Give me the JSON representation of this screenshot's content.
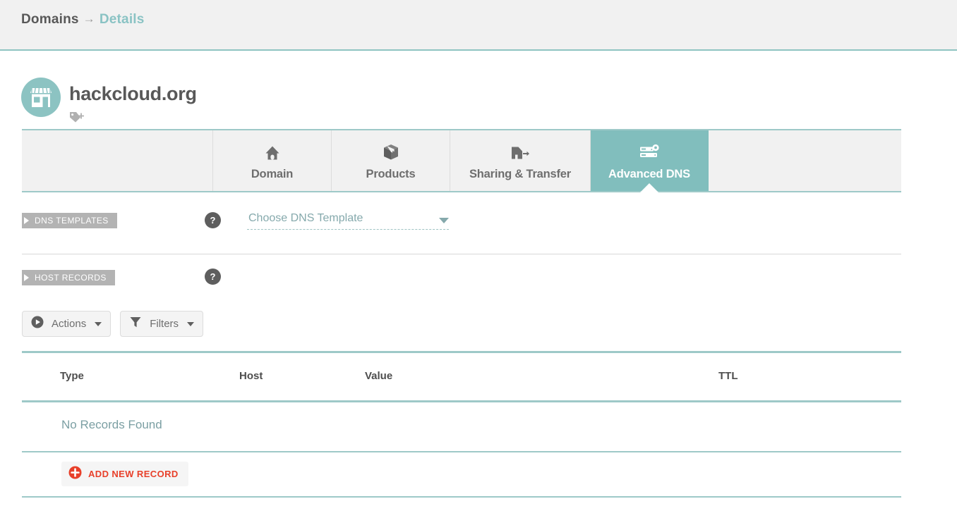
{
  "breadcrumb": {
    "root": "Domains",
    "separator": "→",
    "current": "Details"
  },
  "domain": {
    "name": "hackcloud.org",
    "avatar_icon": "storefront-icon",
    "add_tag_icon": "tag-plus-icon",
    "accent_color": "#8cc3c2"
  },
  "tabs": [
    {
      "label": "Domain",
      "icon": "house-icon",
      "active": false
    },
    {
      "label": "Products",
      "icon": "box-icon",
      "active": false
    },
    {
      "label": "Sharing & Transfer",
      "icon": "transfer-icon",
      "active": false
    },
    {
      "label": "Advanced DNS",
      "icon": "server-gear-icon",
      "active": true
    }
  ],
  "sections": {
    "dns_templates": {
      "ribbon_label": "DNS TEMPLATES",
      "help_label": "?",
      "select": {
        "value": "Choose DNS Template",
        "caret_icon": "chevron-down-icon"
      }
    },
    "host_records": {
      "ribbon_label": "HOST RECORDS",
      "help_label": "?"
    }
  },
  "toolbar": {
    "actions": {
      "label": "Actions",
      "icon": "play-circle-icon",
      "caret_icon": "chevron-down-icon"
    },
    "filters": {
      "label": "Filters",
      "icon": "funnel-icon",
      "caret_icon": "chevron-down-icon"
    }
  },
  "records_table": {
    "columns": [
      "Type",
      "Host",
      "Value",
      "TTL"
    ],
    "rows": [],
    "empty_message": "No Records Found"
  },
  "add_record": {
    "label": "ADD NEW RECORD",
    "icon": "plus-circle-icon",
    "color": "#e8402a"
  },
  "colors": {
    "teal_accent": "#8ac3c4",
    "teal_border": "#9ec9c8",
    "tab_active_bg": "#81bebd",
    "ribbon_gray": "#b3b3b3",
    "text_dark": "#585858",
    "red_accent": "#e8402a"
  }
}
